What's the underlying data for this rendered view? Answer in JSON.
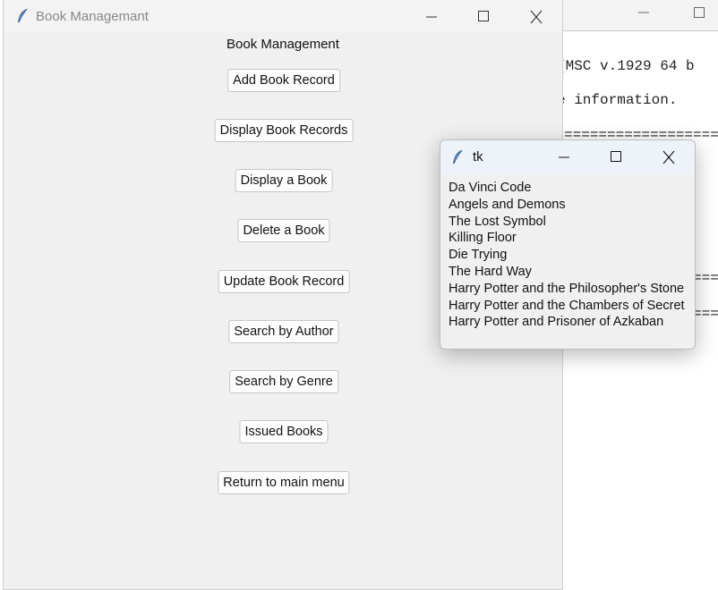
{
  "console": {
    "line1": "[MSC v.1929 64 b",
    "line2": "e information.",
    "rule": "=================="
  },
  "main_window": {
    "title": "Book Managemant",
    "heading": "Book Management",
    "buttons": [
      "Add Book Record",
      "Display Book Records",
      "Display a Book",
      "Delete a Book",
      "Update Book Record",
      "Search by Author",
      "Search by Genre",
      "Issued Books",
      "Return to main menu"
    ]
  },
  "tk_window": {
    "title": "tk",
    "books": [
      "Da Vinci Code",
      "Angels and Demons",
      "The Lost Symbol",
      "Killing Floor",
      "Die Trying",
      "The Hard Way",
      "Harry Potter and the Philosopher's Stone",
      "Harry Potter and the Chambers of Secret",
      "Harry Potter and Prisoner of Azkaban"
    ]
  },
  "icons": {
    "app": "feather-icon",
    "minimize": "minimize-icon",
    "maximize": "maximize-icon",
    "close": "close-icon"
  }
}
